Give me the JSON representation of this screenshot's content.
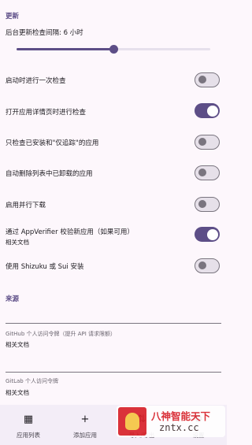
{
  "updates": {
    "section_title": "更新",
    "interval_label": "后台更新检查间隔: 6 小时",
    "interval_slider_fraction": 0.5,
    "settings": [
      {
        "label": "启动时进行一次检查",
        "enabled": false
      },
      {
        "label": "打开应用详情页时进行检查",
        "enabled": true
      },
      {
        "label": "只检查已安装和\"仅追踪\"的应用",
        "enabled": false
      },
      {
        "label": "自动删除列表中已卸载的应用",
        "enabled": false
      },
      {
        "label": "启用并行下载",
        "enabled": false
      },
      {
        "label": "通过 AppVerifier 校验新应用（如果可用）",
        "enabled": true,
        "link": "相关文档"
      },
      {
        "label": "使用 Shizuku 或 Sui 安装",
        "enabled": false,
        "link": "相关文档"
      }
    ]
  },
  "sources": {
    "section_title": "来源",
    "fields": [
      {
        "label": "GitHub 个人访问令牌（提升 API 请求限额）",
        "link": "相关文档"
      },
      {
        "label": "GitLab 个人访问令牌",
        "link": "相关文档"
      }
    ]
  },
  "bottom_nav": {
    "items": [
      {
        "label": "应用列表",
        "icon": "grid-icon",
        "glyph": "▦"
      },
      {
        "label": "添加应用",
        "icon": "plus-icon",
        "glyph": "+"
      },
      {
        "label": "导入/导出",
        "icon": "import-export-icon",
        "glyph": "⇅"
      },
      {
        "label": "设置",
        "icon": "settings-icon",
        "glyph": "⚙"
      }
    ]
  },
  "watermark": {
    "line1": "八神智能天下",
    "line2": "zntx.cc"
  },
  "colors": {
    "accent": "#5d4e87",
    "background": "#fdf7fc",
    "switch_off": "#7a757f"
  }
}
